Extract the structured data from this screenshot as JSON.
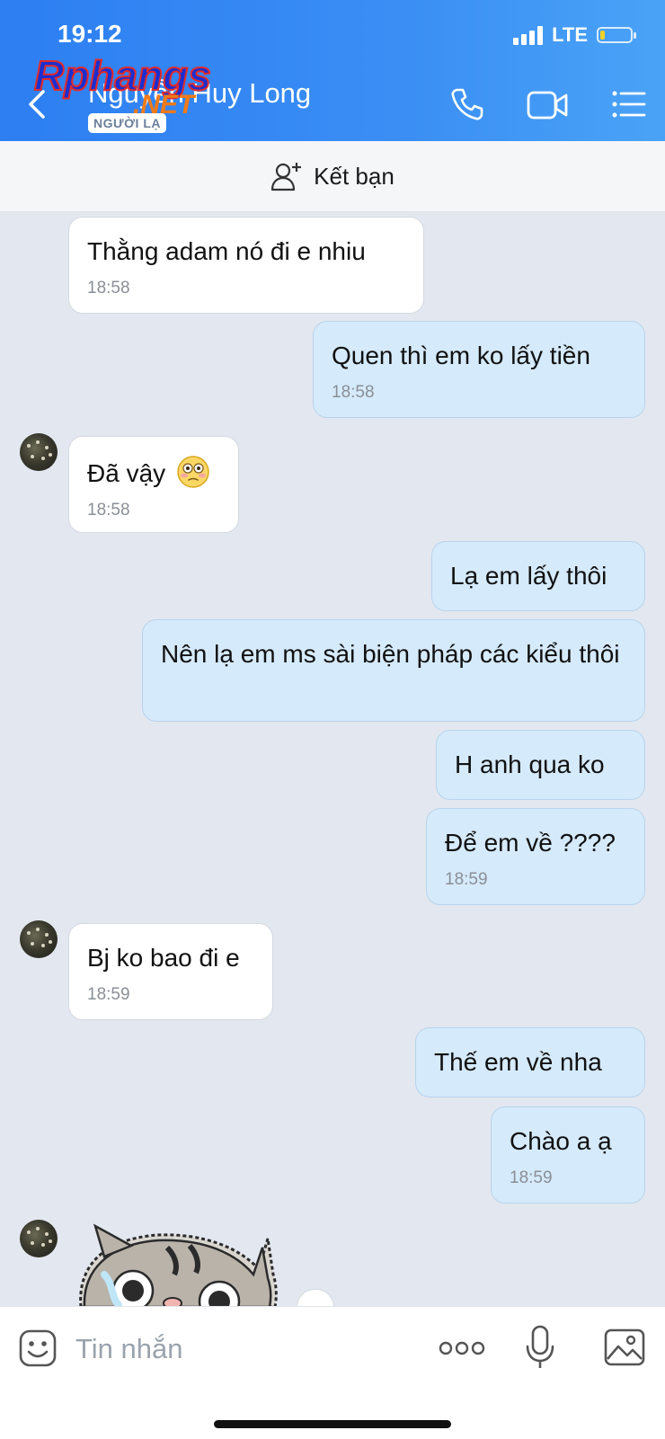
{
  "status_bar": {
    "time": "19:12",
    "network": "LTE",
    "battery_level": 0.15
  },
  "header": {
    "contact_name": "Nguyễn Huy Long",
    "badge": "NGƯỜI LẠ",
    "watermark_main": "Rphangs",
    "watermark_sub": ".NET"
  },
  "friend_bar": {
    "label": "Kết bạn"
  },
  "messages": [
    {
      "side": "in",
      "text": "Thằng adam nó đi e nhiu",
      "time": "18:58"
    },
    {
      "side": "out",
      "text": "Quen thì em ko lấy tiền",
      "time": "18:58"
    },
    {
      "side": "in",
      "text": "Đã vậy",
      "time": "18:58",
      "emoji": "flushed-face"
    },
    {
      "side": "out",
      "text": "Lạ em lấy thôi",
      "time": ""
    },
    {
      "side": "out",
      "text": "Nên lạ em ms sài biện pháp các kiểu thôi",
      "time": ""
    },
    {
      "side": "out",
      "text": "H anh qua ko",
      "time": ""
    },
    {
      "side": "out",
      "text": "Để em về ????",
      "time": "18:59"
    },
    {
      "side": "in",
      "text": "Bj ko bao đi e",
      "time": "18:59"
    },
    {
      "side": "out",
      "text": "Thế em về nha",
      "time": ""
    },
    {
      "side": "out",
      "text": "Chào a ạ",
      "time": "18:59"
    }
  ],
  "composer": {
    "placeholder": "Tin nhắn"
  },
  "icons": {
    "back": "chevron-left-icon",
    "call": "phone-icon",
    "video": "video-camera-icon",
    "menu": "list-menu-icon",
    "add_friend": "add-person-icon",
    "sticker": "smiley-icon",
    "more": "more-dots-icon",
    "mic": "microphone-icon",
    "gallery": "image-icon"
  },
  "colors": {
    "header": "#3a8ef4",
    "bubble_out": "#d5eafb",
    "bubble_in": "#ffffff",
    "background": "#e3e7ef"
  }
}
